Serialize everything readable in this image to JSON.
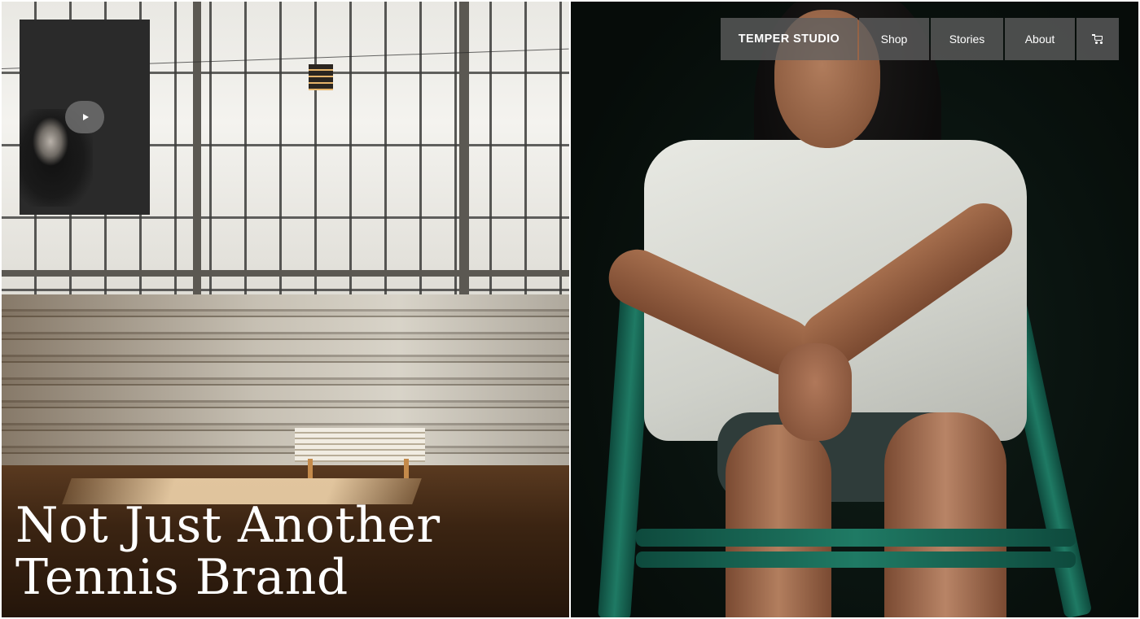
{
  "nav": {
    "brand": "TEMPER STUDIO",
    "items": [
      {
        "label": "Shop"
      },
      {
        "label": "Stories"
      },
      {
        "label": "About"
      }
    ],
    "cart_icon": "shopping-cart-icon"
  },
  "hero": {
    "title_line1": "Not Just Another",
    "title_line2": "Tennis Brand"
  },
  "video": {
    "play_icon": "play-icon"
  },
  "colors": {
    "text": "#ffffff",
    "nav_background": "#5f5f5f",
    "chair_green": "#1f7a64"
  }
}
